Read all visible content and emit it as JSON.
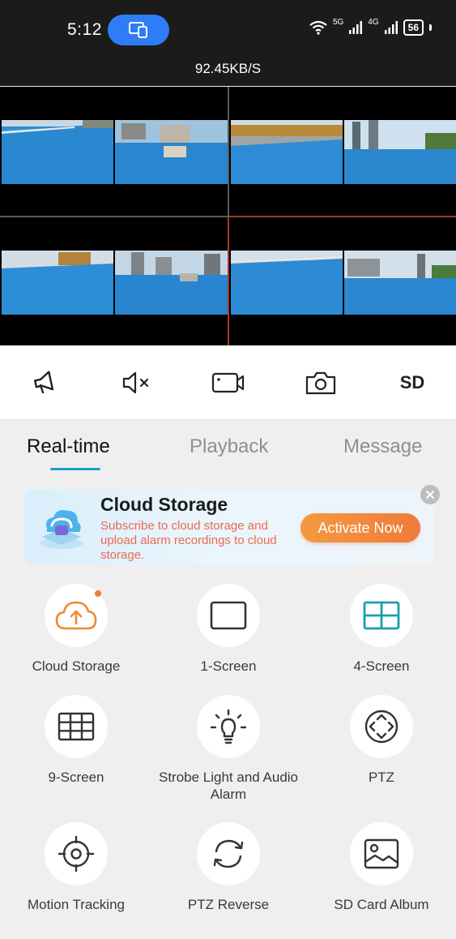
{
  "status_bar": {
    "time": "5:12",
    "net_5g": "5G",
    "net_4g": "4G",
    "battery": "56"
  },
  "stream": {
    "speed": "92.45KB/S"
  },
  "controls": {
    "sd_label": "SD"
  },
  "tabs": [
    {
      "label": "Real-time",
      "active": true
    },
    {
      "label": "Playback",
      "active": false
    },
    {
      "label": "Message",
      "active": false
    }
  ],
  "banner": {
    "title": "Cloud Storage",
    "description": "Subscribe to cloud storage and upload alarm recordings to cloud storage.",
    "button_label": "Activate Now"
  },
  "features": [
    {
      "label": "Cloud Storage",
      "icon": "cloud-upload-icon"
    },
    {
      "label": "1-Screen",
      "icon": "single-screen-icon"
    },
    {
      "label": "4-Screen",
      "icon": "four-screen-icon"
    },
    {
      "label": "9-Screen",
      "icon": "nine-screen-icon"
    },
    {
      "label": "Strobe Light and Audio Alarm",
      "icon": "light-bulb-icon"
    },
    {
      "label": "PTZ",
      "icon": "ptz-icon"
    },
    {
      "label": "Motion Tracking",
      "icon": "crosshair-icon"
    },
    {
      "label": "PTZ Reverse",
      "icon": "rotate-icon"
    },
    {
      "label": "SD Card Album",
      "icon": "image-album-icon"
    }
  ],
  "colors": {
    "accent": "#1aa0c8",
    "brand_orange": "#f07a3b",
    "pool_blue": "#2f8fd6",
    "cast_blue": "#2f7df6"
  }
}
